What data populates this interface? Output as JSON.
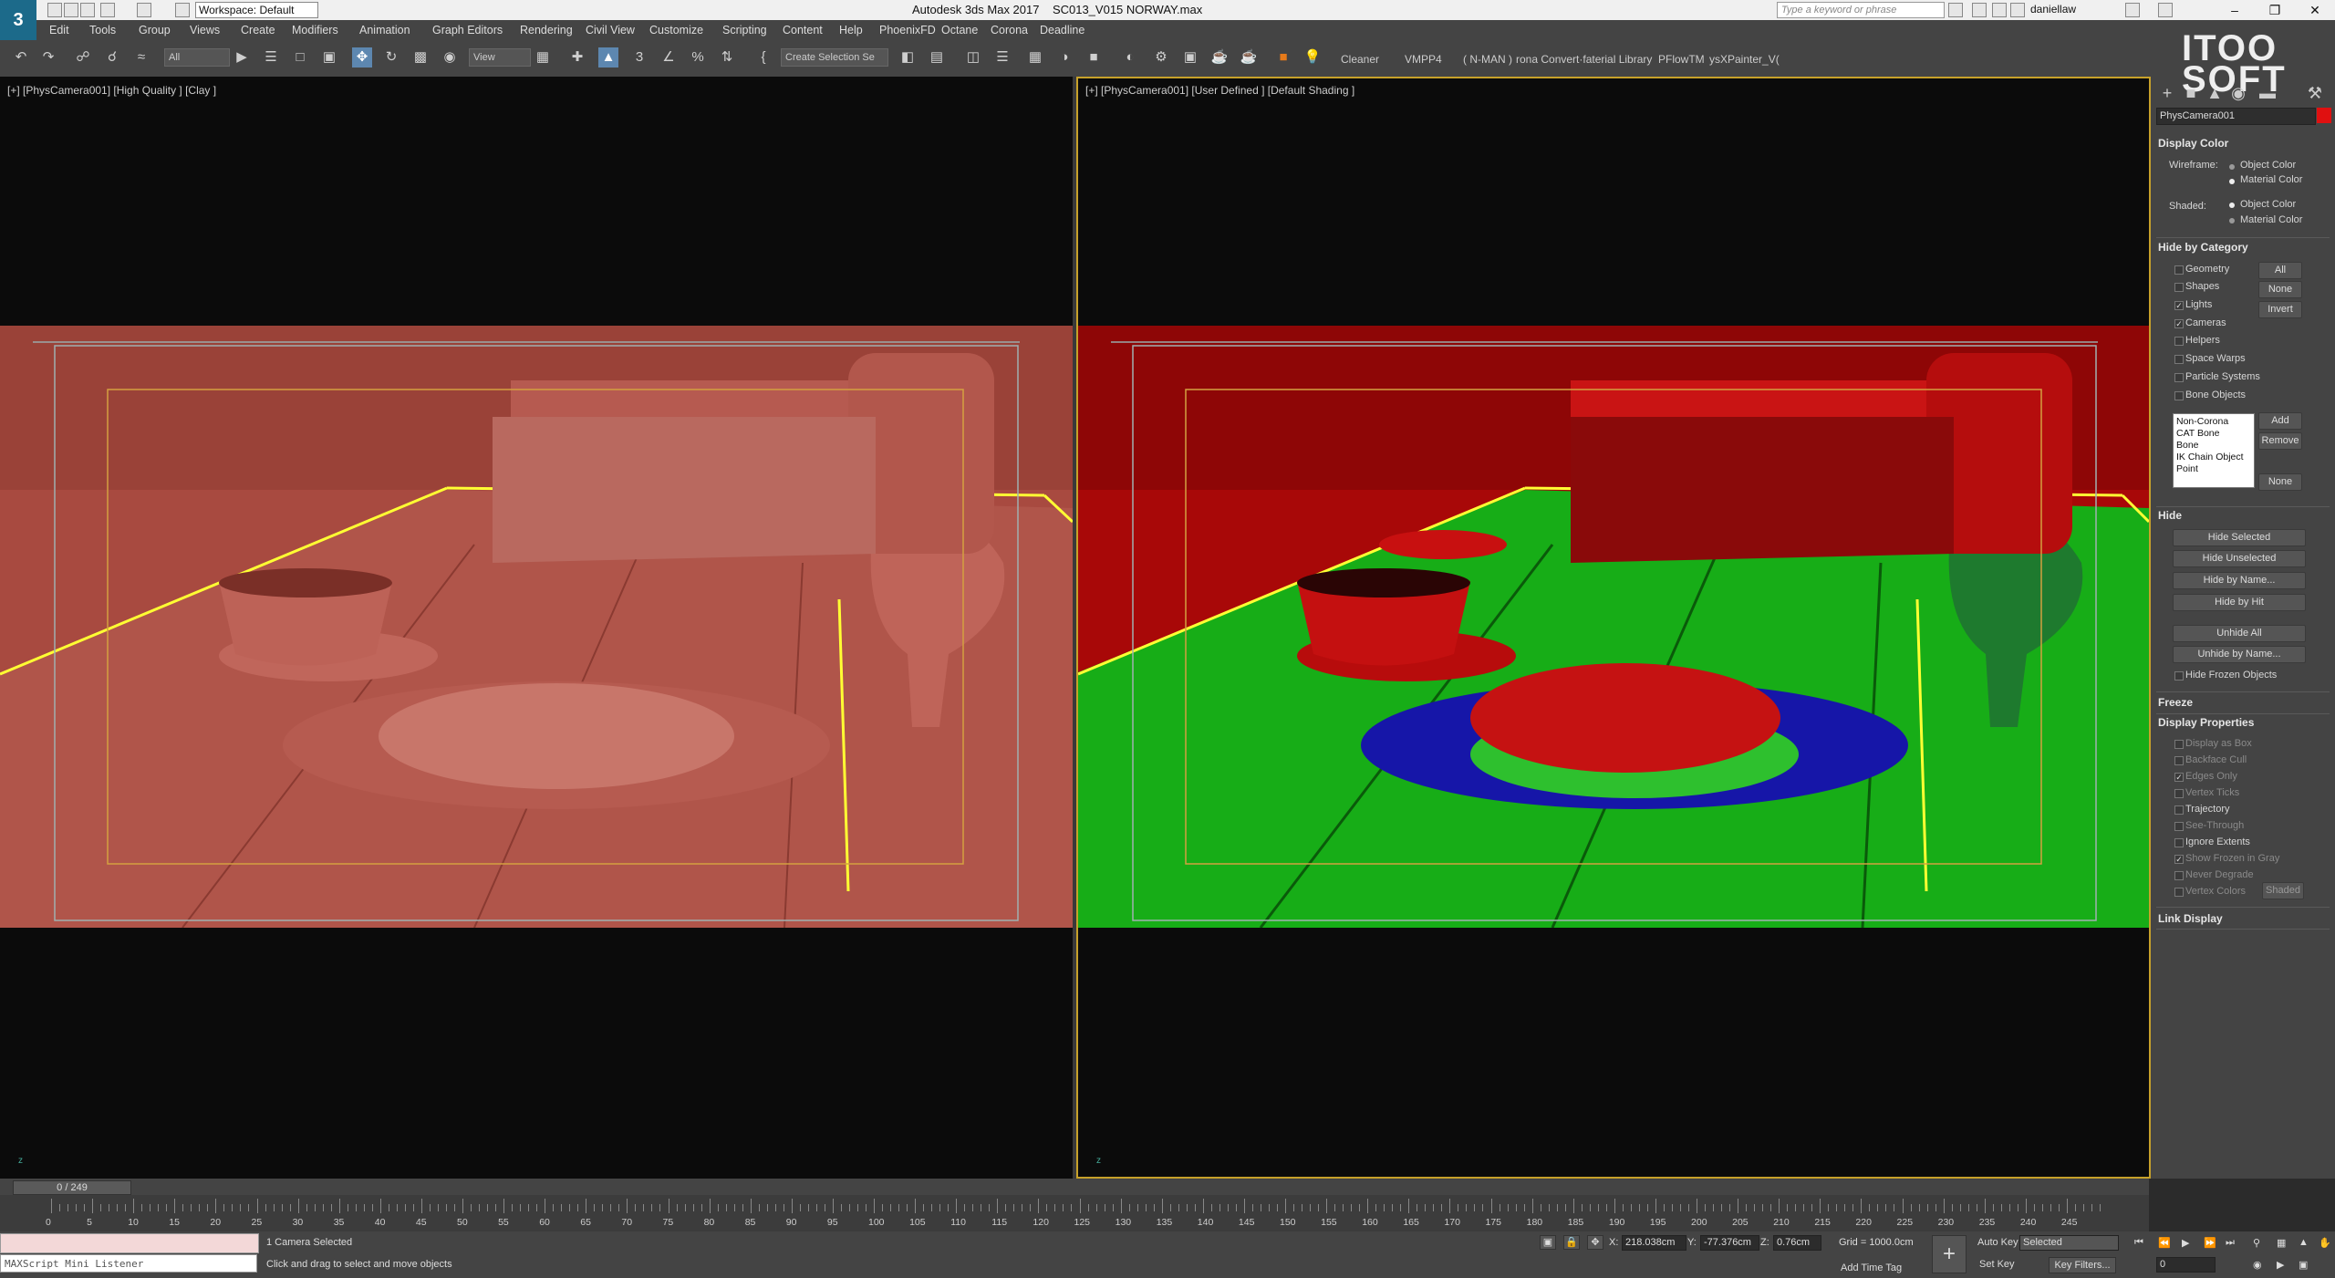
{
  "window": {
    "app_title": "Autodesk 3ds Max 2017",
    "file_name": "SC013_V015 NORWAY.max",
    "workspace": "Workspace: Default",
    "search_placeholder": "Type a keyword or phrase",
    "user": "daniellaw"
  },
  "menu": [
    "Edit",
    "Tools",
    "Group",
    "Views",
    "Create",
    "Modifiers",
    "Animation",
    "Graph Editors",
    "Rendering",
    "Civil View",
    "Customize",
    "Scripting",
    "Content",
    "Help",
    "PhoenixFD",
    "Octane",
    "Corona",
    "Deadline"
  ],
  "toolbar": {
    "selection_filter": "All",
    "ref_coord": "View",
    "named_sel": "Create Selection Se",
    "shelf": [
      "Cleaner",
      "VMPP4",
      "( N-MAN )",
      "rona Convert·faterial Library",
      "PFlowTM",
      "ysXPainter_V("
    ]
  },
  "viewports": {
    "left_label": "[+] [PhysCamera001] [High Quality ] [Clay ]",
    "right_label": "[+] [PhysCamera001] [User Defined ] [Default Shading ]",
    "axis_label": "z"
  },
  "colors": {
    "clay": "#b0554a",
    "red": "#c21010",
    "green": "#18b318",
    "blue": "#1a1ab0",
    "accent": "#5d87b0",
    "selected_object": "#e01010"
  },
  "panel": {
    "logo_line1": "ITOO",
    "logo_line2": "SOFT",
    "object_name": "PhysCamera001",
    "display_color": {
      "title": "Display Color",
      "wireframe_label": "Wireframe:",
      "shaded_label": "Shaded:",
      "object_color": "Object Color",
      "material_color": "Material Color"
    },
    "hide_by_category": {
      "title": "Hide by Category",
      "items": [
        "Geometry",
        "Shapes",
        "Lights",
        "Cameras",
        "Helpers",
        "Space Warps",
        "Particle Systems",
        "Bone Objects"
      ],
      "buttons": [
        "All",
        "None",
        "Invert"
      ],
      "list": [
        "Non-Corona",
        "CAT Bone",
        "Bone",
        "IK Chain Object",
        "Point"
      ],
      "add": "Add",
      "remove": "Remove",
      "none": "None"
    },
    "hide": {
      "title": "Hide",
      "buttons": [
        "Hide Selected",
        "Hide Unselected",
        "Hide by Name...",
        "Hide by Hit",
        "Unhide All",
        "Unhide by Name..."
      ],
      "frozen": "Hide Frozen Objects"
    },
    "freeze_title": "Freeze",
    "display_properties": {
      "title": "Display Properties",
      "items": [
        "Display as Box",
        "Backface Cull",
        "Edges Only",
        "Vertex Ticks",
        "Trajectory",
        "See-Through",
        "Ignore Extents",
        "Show Frozen in Gray",
        "Never Degrade",
        "Vertex Colors"
      ],
      "shaded_btn": "Shaded"
    },
    "link_display_title": "Link Display"
  },
  "timeline": {
    "slider": "0 / 249",
    "labels": [
      "0",
      "5",
      "10",
      "15",
      "20",
      "25",
      "30",
      "35",
      "40",
      "45",
      "50",
      "55",
      "60",
      "65",
      "70",
      "75",
      "80",
      "85",
      "90",
      "95",
      "100",
      "105",
      "110",
      "115",
      "120",
      "125",
      "130",
      "135",
      "140",
      "145",
      "150",
      "155",
      "160",
      "165",
      "170",
      "175",
      "180",
      "185",
      "190",
      "195",
      "200",
      "205",
      "210",
      "215",
      "220",
      "225",
      "230",
      "235",
      "240",
      "245"
    ]
  },
  "status": {
    "listener": "MAXScript Mini Listener",
    "selected": "1 Camera Selected",
    "prompt": "Click and drag to select and move objects",
    "x_label": "X:",
    "x": "218.038cm",
    "y_label": "Y:",
    "y": "-77.376cm",
    "z_label": "Z:",
    "z": "0.76cm",
    "grid": "Grid = 1000.0cm",
    "add_time_tag": "Add Time Tag",
    "auto_key": "Auto Key",
    "set_key": "Set Key",
    "key_mode": "Selected",
    "key_filters": "Key Filters...",
    "frame": "0"
  }
}
